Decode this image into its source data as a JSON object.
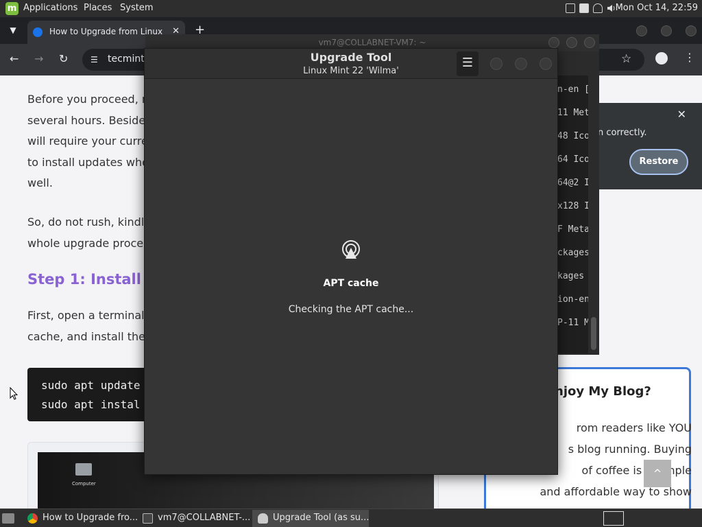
{
  "top_panel": {
    "menus": [
      "Applications",
      "Places",
      "System"
    ],
    "clock": "Mon Oct 14, 22:59"
  },
  "browser": {
    "tab_title": "How to Upgrade from Linux",
    "address": "tecmint.",
    "restore_popup": {
      "text": "n correctly.",
      "button": "Restore"
    }
  },
  "article": {
    "para1": [
      "Before you proceed, n",
      "several hours. Besides",
      "will require your curre",
      "to install updates whe",
      "well."
    ],
    "para2": [
      "So, do not rush, kindly",
      "whole upgrade proces"
    ],
    "step_heading": "Step 1: Install mi",
    "para3": [
      "First, open a terminal,",
      "cache, and install the"
    ],
    "code_lines": [
      "sudo apt update",
      "sudo apt instal"
    ],
    "desktop_icon_label": "Computer",
    "sidebar": {
      "title": "njoy My Blog?",
      "lines": [
        "rom readers like YOU",
        "s blog running. Buying",
        "of coffee is a simple",
        "and affordable way to show"
      ]
    },
    "scroll_top_icon": "^"
  },
  "terminal": {
    "title": "vm7@COLLABNET-VM7: ~",
    "lines": [
      "n-en [",
      "11 Met",
      "48 Ico",
      "64 Ico",
      "64@2 I",
      "x128 I",
      "F Meta",
      "ckages",
      "kages",
      "ion-en",
      "P-11 M"
    ]
  },
  "upgrade_tool": {
    "title": "Upgrade Tool",
    "subtitle": "Linux Mint 22 'Wilma'",
    "status_icon": "refresh-icon",
    "status_title": "APT cache",
    "status_text": "Checking the APT cache..."
  },
  "taskbar": {
    "tasks": [
      "How to Upgrade fro...",
      "vm7@COLLABNET-...",
      "Upgrade Tool (as su..."
    ]
  },
  "colors": {
    "accent_heading": "#8a63d2",
    "sidebar_border": "#3c78d8",
    "mint_green": "#7fbf3f"
  }
}
